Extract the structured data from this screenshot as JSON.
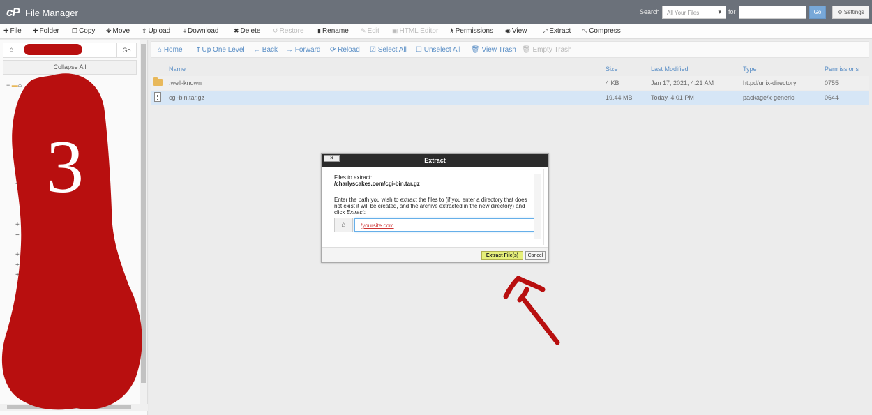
{
  "header": {
    "logo": "cP",
    "title": "File Manager",
    "search_label": "Search",
    "search_scope": "All Your Files",
    "for_label": "for",
    "search_value": "",
    "go_label": "Go",
    "settings_label": "Settings",
    "settings_icon": "gear-icon"
  },
  "toolbar": [
    {
      "label": "File",
      "icon": "plus-icon",
      "disabled": false
    },
    {
      "label": "Folder",
      "icon": "plus-icon",
      "disabled": false
    },
    {
      "label": "Copy",
      "icon": "copy-icon",
      "disabled": false
    },
    {
      "label": "Move",
      "icon": "move-icon",
      "disabled": false
    },
    {
      "label": "Upload",
      "icon": "upload-icon",
      "disabled": false
    },
    {
      "label": "Download",
      "icon": "download-icon",
      "disabled": false
    },
    {
      "label": "Delete",
      "icon": "close-icon",
      "disabled": false
    },
    {
      "label": "Restore",
      "icon": "undo-icon",
      "disabled": true
    },
    {
      "label": "Rename",
      "icon": "file-icon",
      "disabled": false
    },
    {
      "label": "Edit",
      "icon": "pencil-icon",
      "disabled": true
    },
    {
      "label": "HTML Editor",
      "icon": "html-icon",
      "disabled": true
    },
    {
      "label": "Permissions",
      "icon": "key-icon",
      "disabled": false
    },
    {
      "label": "View",
      "icon": "eye-icon",
      "disabled": false
    },
    {
      "label": "Extract",
      "icon": "expand-icon",
      "disabled": false
    },
    {
      "label": "Compress",
      "icon": "compress-icon",
      "disabled": false
    }
  ],
  "left_pane": {
    "path_value": "",
    "go_label": "Go",
    "collapse_all_label": "Collapse All",
    "tree_toggles": [
      "−",
      "+",
      "+",
      "+",
      "−",
      "+",
      "+",
      "+"
    ]
  },
  "action_bar": [
    {
      "label": "Home",
      "icon": "home-icon",
      "disabled": false
    },
    {
      "label": "Up One Level",
      "icon": "level-up-icon",
      "disabled": false
    },
    {
      "label": "Back",
      "icon": "arrow-left-icon",
      "disabled": false
    },
    {
      "label": "Forward",
      "icon": "arrow-right-icon",
      "disabled": false
    },
    {
      "label": "Reload",
      "icon": "reload-icon",
      "disabled": false
    },
    {
      "label": "Select All",
      "icon": "checkbox-checked-icon",
      "disabled": false
    },
    {
      "label": "Unselect All",
      "icon": "checkbox-empty-icon",
      "disabled": false
    },
    {
      "label": "View Trash",
      "icon": "trash-icon",
      "disabled": false
    },
    {
      "label": "Empty Trash",
      "icon": "trash-icon",
      "disabled": true
    }
  ],
  "table": {
    "headers": [
      "Name",
      "Size",
      "Last Modified",
      "Type",
      "Permissions"
    ],
    "rows": [
      {
        "icon": "folder-icon",
        "name": ".well-known",
        "size": "4 KB",
        "modified": "Jan 17, 2021, 4:21 AM",
        "type": "httpd/unix-directory",
        "perms": "0755",
        "selected": false
      },
      {
        "icon": "archive-file-icon",
        "name": "cgi-bin.tar.gz",
        "size": "19.44 MB",
        "modified": "Today, 4:01 PM",
        "type": "package/x-generic",
        "perms": "0644",
        "selected": true
      }
    ]
  },
  "modal": {
    "title": "Extract",
    "close_label": "×",
    "files_label": "Files to extract:",
    "files_path": "/charlyscakes.com/cgi-bin.tar.gz",
    "instruction_prefix": "Enter the path you wish to extract the files to (if you enter a directory that does not exist it will be created, and the archive extracted in the new directory) and click ",
    "instruction_emph": "Extract",
    "instruction_suffix": ":",
    "path_value": "/yoursite.com",
    "extract_label": "Extract File(s)",
    "cancel_label": "Cancel"
  },
  "annotation": {
    "step_number": "3",
    "color": "#b80f0f"
  },
  "colors": {
    "header_bg": "#6b717a",
    "link_blue": "#5b8fc6",
    "selected_row": "#d6e6f6",
    "extract_button": "#e6f07a"
  }
}
